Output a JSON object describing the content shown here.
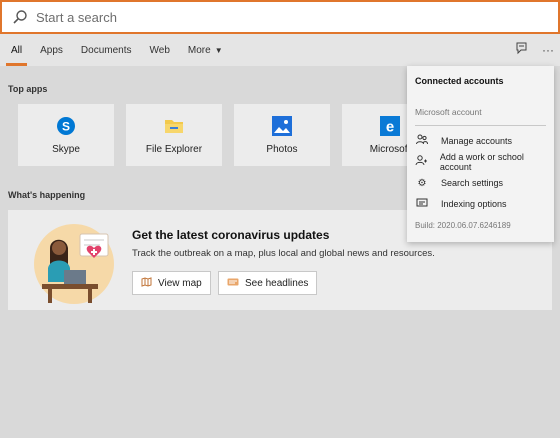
{
  "search": {
    "placeholder": "Start a search"
  },
  "tabs": [
    {
      "label": "All"
    },
    {
      "label": "Apps"
    },
    {
      "label": "Documents"
    },
    {
      "label": "Web"
    },
    {
      "label": "More"
    }
  ],
  "top_apps": {
    "title": "Top apps",
    "apps": [
      {
        "label": "Skype",
        "icon": "skype-icon",
        "color": "#0078d4"
      },
      {
        "label": "File Explorer",
        "icon": "folder-icon",
        "color": "#f2c94c"
      },
      {
        "label": "Photos",
        "icon": "photos-icon",
        "color": "#1e6fd9"
      },
      {
        "label": "Microsoft",
        "icon": "edge-icon",
        "color": "#0a7ad6"
      }
    ]
  },
  "happening": {
    "title": "What's happening",
    "headline": "Get the latest coronavirus updates",
    "subtitle": "Track the outbreak on a map, plus local and global news and resources.",
    "btn_map": "View map",
    "btn_headlines": "See headlines"
  },
  "menu": {
    "title": "Connected accounts",
    "account": "Microsoft account",
    "items": [
      {
        "label": "Manage accounts",
        "icon": "people-icon"
      },
      {
        "label": "Add a work or school account",
        "icon": "person-add-icon"
      },
      {
        "label": "Search settings",
        "icon": "gear-icon"
      },
      {
        "label": "Indexing options",
        "icon": "indexing-icon"
      }
    ],
    "build": "Build: 2020.06.07.6246189"
  },
  "colors": {
    "accent": "#e0762c",
    "background": "#d9d9d9"
  }
}
